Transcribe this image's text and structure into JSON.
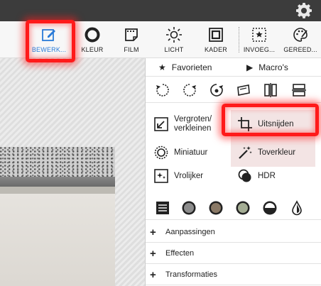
{
  "header": {
    "settings_icon": "gear-icon"
  },
  "toolbar": {
    "tools": [
      {
        "label": "BEWERK...",
        "icon": "edit-icon",
        "active": true
      },
      {
        "label": "KLEUR",
        "icon": "color-ring-icon"
      },
      {
        "label": "FILM",
        "icon": "film-icon"
      },
      {
        "label": "LICHT",
        "icon": "sun-icon"
      },
      {
        "label": "KADER",
        "icon": "frame-icon"
      },
      {
        "label": "INVOEG...",
        "icon": "insert-star-icon"
      },
      {
        "label": "GEREED...",
        "icon": "palette-icon"
      }
    ],
    "accent_color": "#2a7bd8"
  },
  "panel": {
    "favorites": {
      "label": "Favorieten",
      "icon": "star-icon"
    },
    "macros": {
      "label": "Macro's",
      "icon": "play-icon"
    },
    "quick_icons": [
      "rotate-left-icon",
      "rotate-right-icon",
      "rotate-custom-icon",
      "straighten-icon",
      "flip-horizontal-icon",
      "flip-vertical-icon"
    ],
    "tools": [
      {
        "id": "resize",
        "label_line1": "Vergroten/",
        "label_line2": "verkleinen",
        "icon": "resize-icon"
      },
      {
        "id": "crop",
        "label_line1": "Uitsnijden",
        "icon": "crop-icon"
      },
      {
        "id": "thumbnail",
        "label_line1": "Miniatuur",
        "icon": "thumbnail-icon"
      },
      {
        "id": "magic",
        "label_line1": "Toverkleur",
        "icon": "magic-wand-icon"
      },
      {
        "id": "brighten",
        "label_line1": "Vrolijker",
        "icon": "sparkle-icon"
      },
      {
        "id": "hdr",
        "label_line1": "HDR",
        "icon": "hdr-icon"
      }
    ],
    "color_icons": [
      "lines-icon",
      "gray-circle-icon",
      "brown-circle-icon",
      "green-circle-icon",
      "half-circle-icon",
      "drop-icon"
    ],
    "accordions": [
      {
        "label": "Aanpassingen"
      },
      {
        "label": "Effecten"
      },
      {
        "label": "Transformaties"
      }
    ]
  }
}
